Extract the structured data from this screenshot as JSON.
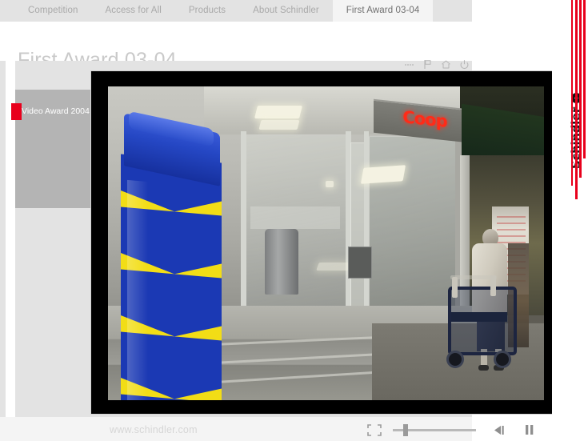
{
  "nav": {
    "items": [
      {
        "label": "Competition",
        "active": false
      },
      {
        "label": "Access for All",
        "active": false
      },
      {
        "label": "Products",
        "active": false
      },
      {
        "label": "About Schindler",
        "active": false
      },
      {
        "label": "First Award 03-04",
        "active": true
      }
    ]
  },
  "page": {
    "title": "First Award 03-04",
    "url": "www.schindler.com"
  },
  "sidebar": {
    "items": [
      {
        "label": "Video Award 2004",
        "marker_color": "#e8001c"
      }
    ]
  },
  "player_toolbar": {
    "icons": [
      {
        "name": "more-dots-icon",
        "glyph": "⋯"
      },
      {
        "name": "flag-icon",
        "glyph": "⚑"
      },
      {
        "name": "home-icon",
        "glyph": "⌂"
      },
      {
        "name": "power-icon",
        "glyph": "⏻"
      }
    ]
  },
  "video": {
    "scene_description": "Coop store entrance with blue and yellow chevron striped pillar in foreground and elderly woman with a rollator walker",
    "coop_sign_text": "Coop",
    "frame_color": "#000000"
  },
  "controls": {
    "fullscreen_label": "Fullscreen",
    "seek_position_percent": 12,
    "step_back_label": "Step back",
    "pause_label": "Pause"
  },
  "brand": {
    "name": "Schindler",
    "mark_glyph": "↑",
    "accent_color": "#e8001c"
  }
}
